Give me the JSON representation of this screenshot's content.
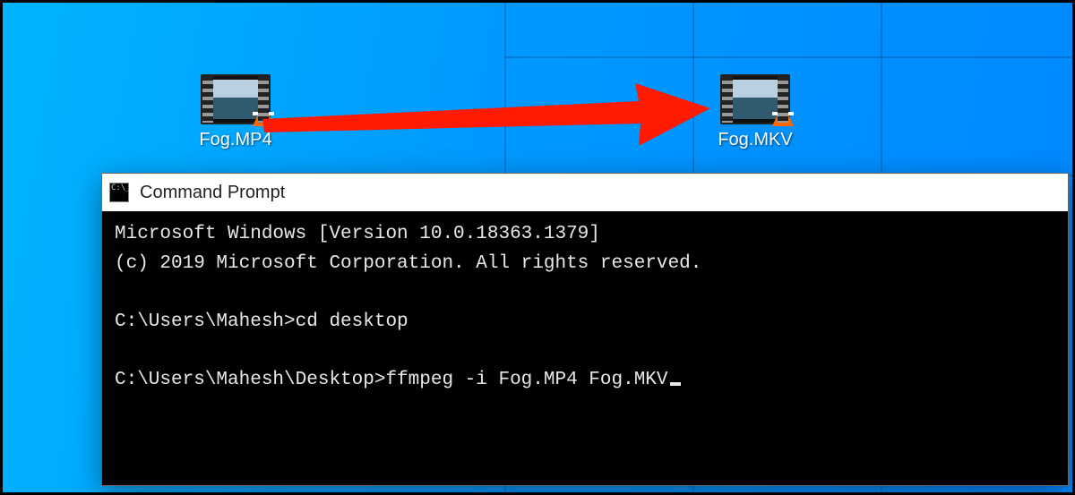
{
  "desktop": {
    "icons": [
      {
        "label": "Fog.MP4"
      },
      {
        "label": "Fog.MKV"
      }
    ]
  },
  "cmd": {
    "title": "Command Prompt",
    "line_version": "Microsoft Windows [Version 10.0.18363.1379]",
    "line_copyright": "(c) 2019 Microsoft Corporation. All rights reserved.",
    "prompt1": "C:\\Users\\Mahesh>",
    "command1": "cd desktop",
    "prompt2": "C:\\Users\\Mahesh\\Desktop>",
    "command2": "ffmpeg -i Fog.MP4 Fog.MKV"
  },
  "arrow": {
    "color": "#ff1a00"
  }
}
